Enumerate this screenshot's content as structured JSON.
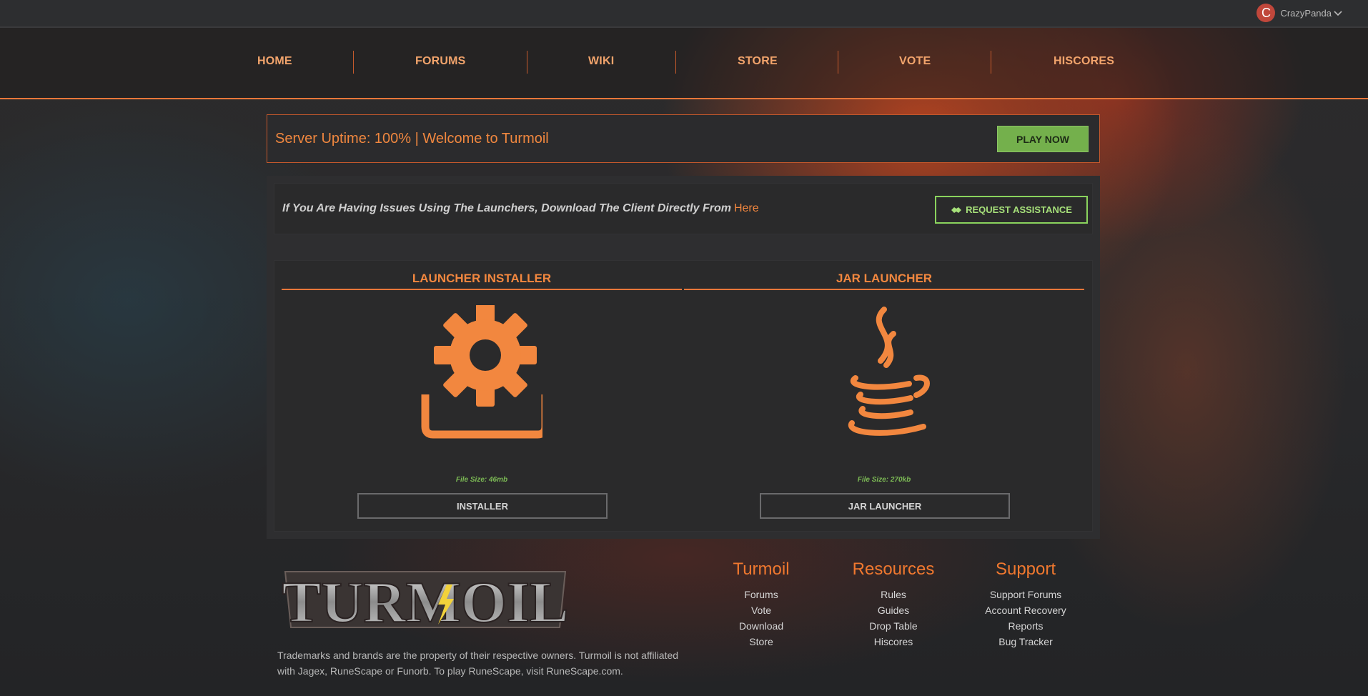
{
  "user": {
    "initial": "C",
    "name": "CrazyPanda"
  },
  "nav": [
    "HOME",
    "FORUMS",
    "WIKI",
    "STORE",
    "VOTE",
    "HISCORES"
  ],
  "uptime": {
    "text": "Server Uptime: 100% | Welcome to Turmoil",
    "play_label": "PLAY NOW"
  },
  "notice": {
    "text": "If You Are Having Issues Using The Launchers, Download The Client Directly From",
    "link": "Here",
    "assist_label": "REQUEST ASSISTANCE"
  },
  "downloads": [
    {
      "title": "LAUNCHER INSTALLER",
      "icon": "gear-download-icon",
      "size": "File Size: 46mb",
      "button": "INSTALLER"
    },
    {
      "title": "JAR LAUNCHER",
      "icon": "java-icon",
      "size": "File Size: 270kb",
      "button": "JAR LAUNCHER"
    }
  ],
  "footer": {
    "logo_text": "TURMOIL",
    "disclaimer": "Trademarks and brands are the property of their respective owners. Turmoil is not affiliated with Jagex, RuneScape or Funorb. To play RuneScape, visit RuneScape.com.",
    "columns": [
      {
        "title": "Turmoil",
        "links": [
          "Forums",
          "Vote",
          "Download",
          "Store"
        ]
      },
      {
        "title": "Resources",
        "links": [
          "Rules",
          "Guides",
          "Drop Table",
          "Hiscores"
        ]
      },
      {
        "title": "Support",
        "links": [
          "Support Forums",
          "Account Recovery",
          "Reports",
          "Bug Tracker"
        ]
      }
    ]
  },
  "colors": {
    "accent": "#f2873f",
    "green": "#74b04c",
    "nav_text": "#f2a46c"
  }
}
